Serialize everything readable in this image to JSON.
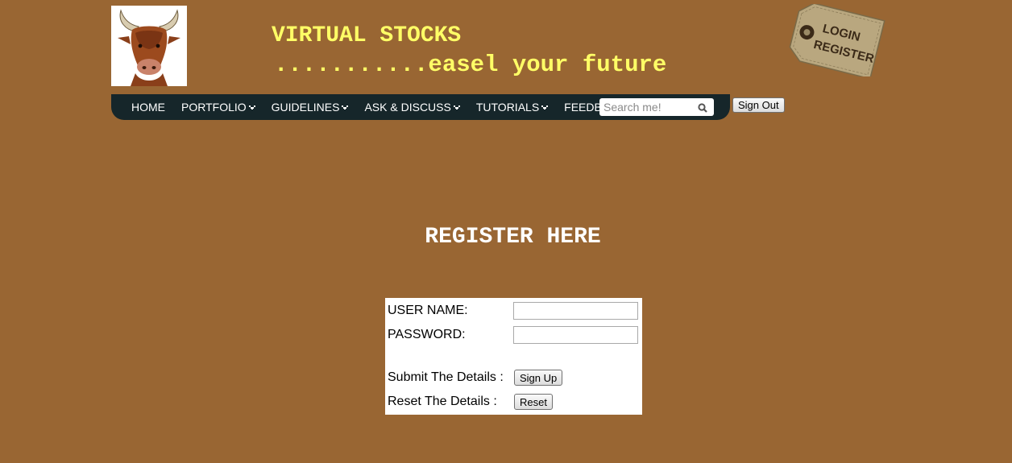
{
  "header": {
    "title": "VIRTUAL STOCKS",
    "tagline": "...........easel your future",
    "logo_icon": "bull-head-icon",
    "tag": {
      "icon": "hang-tag-icon",
      "line1": "LOGIN",
      "line2": "REGISTER"
    }
  },
  "nav": {
    "items": [
      {
        "label": "HOME",
        "has_dropdown": false
      },
      {
        "label": "PORTFOLIO",
        "has_dropdown": true
      },
      {
        "label": "GUIDELINES",
        "has_dropdown": true
      },
      {
        "label": "ASK & DISCUSS",
        "has_dropdown": true
      },
      {
        "label": "TUTORIALS",
        "has_dropdown": true
      },
      {
        "label": "FEEDBACK",
        "has_dropdown": false
      }
    ],
    "search": {
      "placeholder": "Search me!",
      "value": "",
      "icon": "search-icon"
    },
    "signout_label": "Sign Out"
  },
  "main": {
    "heading": "REGISTER HERE",
    "form": {
      "username_label": "USER NAME:",
      "username_value": "",
      "password_label": "PASSWORD:",
      "password_value": "",
      "submit_label": "Submit The Details :",
      "submit_button": "Sign Up",
      "reset_label": "Reset The Details :",
      "reset_button": "Reset"
    }
  },
  "colors": {
    "background": "#996633",
    "title": "#ffff66",
    "navbar": "#16262a",
    "heading": "#ffffff"
  }
}
